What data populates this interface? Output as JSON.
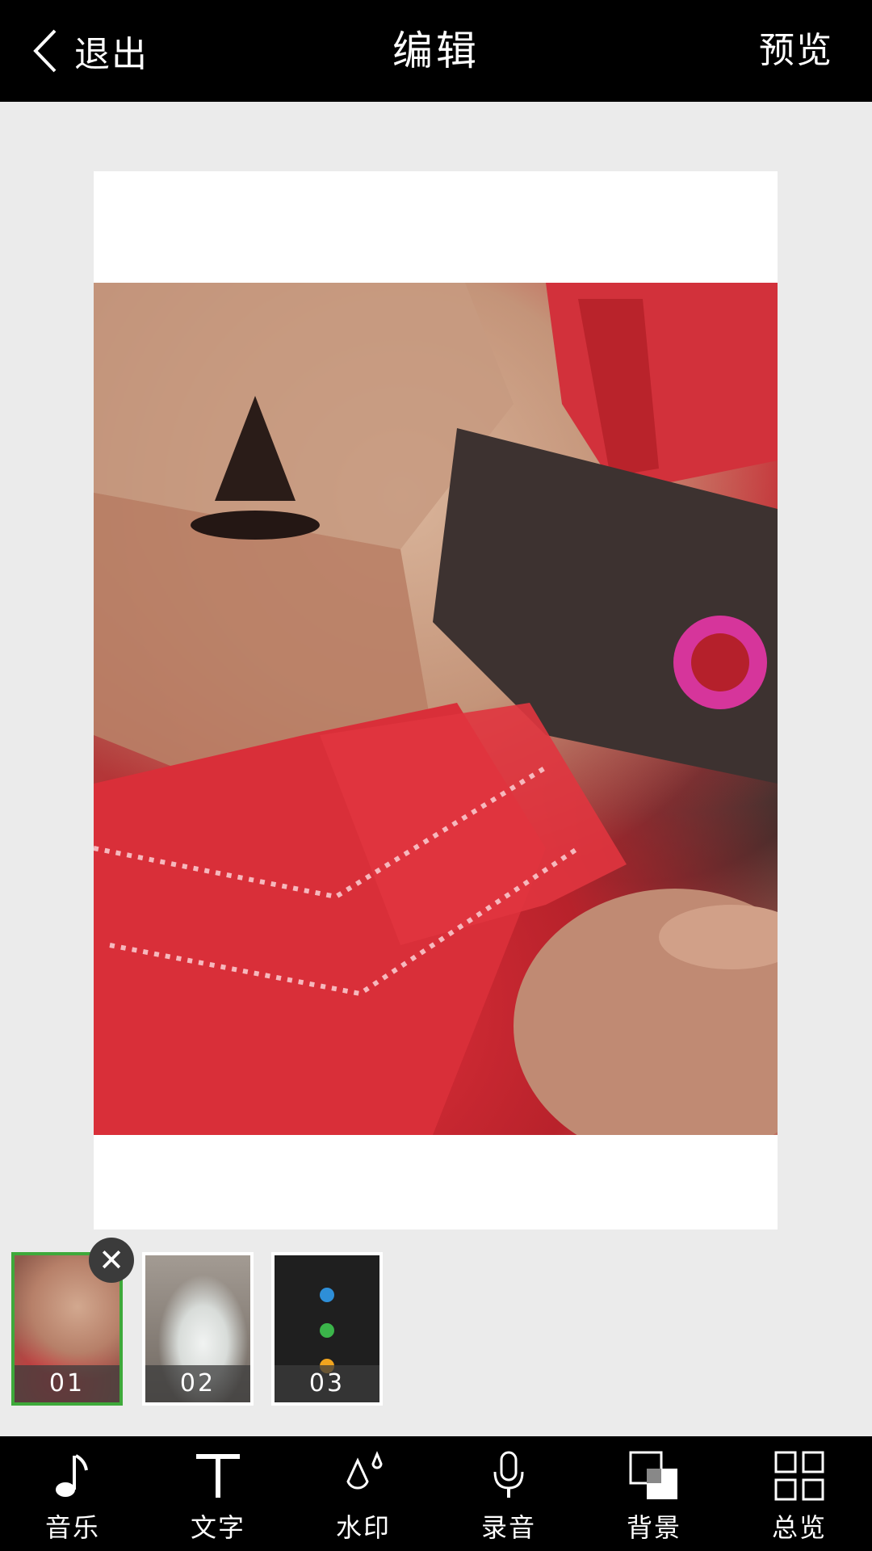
{
  "header": {
    "back_label": "退出",
    "title": "编辑",
    "preview_label": "预览"
  },
  "thumbnails": [
    {
      "number": "01",
      "selected": true
    },
    {
      "number": "02",
      "selected": false
    },
    {
      "number": "03",
      "selected": false
    }
  ],
  "toolbar": {
    "items": [
      {
        "label": "音乐",
        "icon": "music-note-icon"
      },
      {
        "label": "文字",
        "icon": "text-icon"
      },
      {
        "label": "水印",
        "icon": "watermark-drop-icon"
      },
      {
        "label": "录音",
        "icon": "microphone-icon"
      },
      {
        "label": "背景",
        "icon": "background-layers-icon"
      },
      {
        "label": "总览",
        "icon": "grid-overview-icon"
      }
    ]
  },
  "colors": {
    "selected_border": "#3ea93a",
    "bars": "#000000",
    "workspace": "#ebebeb"
  }
}
